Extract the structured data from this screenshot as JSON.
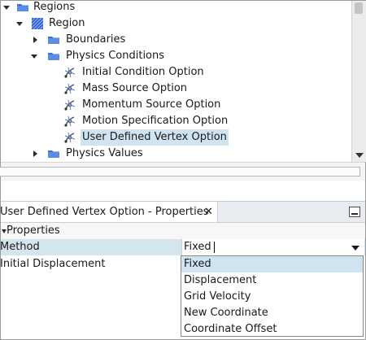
{
  "tree": {
    "items": [
      {
        "label": "Regions",
        "icon": "folder-icon"
      },
      {
        "label": "Region",
        "icon": "region-icon"
      },
      {
        "label": "Boundaries",
        "icon": "folder-icon"
      },
      {
        "label": "Physics Conditions",
        "icon": "folder-icon"
      },
      {
        "label": "Initial Condition Option",
        "icon": "physics-condition-icon"
      },
      {
        "label": "Mass Source Option",
        "icon": "physics-condition-icon"
      },
      {
        "label": "Momentum Source Option",
        "icon": "physics-condition-icon"
      },
      {
        "label": "Motion Specification Option",
        "icon": "physics-condition-icon"
      },
      {
        "label": "User Defined Vertex Option",
        "icon": "physics-condition-icon"
      },
      {
        "label": "Physics Values",
        "icon": "folder-icon"
      }
    ],
    "selected_index": 8
  },
  "properties": {
    "tab_title": "User Defined Vertex Option - Properties",
    "close_glyph": "✕",
    "section_label": "Properties",
    "rows": [
      {
        "name": "Method",
        "value": "Fixed"
      },
      {
        "name": "Initial Displacement",
        "value": ""
      }
    ]
  },
  "dropdown": {
    "options": [
      "Fixed",
      "Displacement",
      "Grid Velocity",
      "New Coordinate",
      "Coordinate Offset"
    ],
    "selected": "Fixed"
  },
  "colors": {
    "selection": "#cfe4f0",
    "folder": "#3a6fd0",
    "region": "#2f5fd8"
  }
}
